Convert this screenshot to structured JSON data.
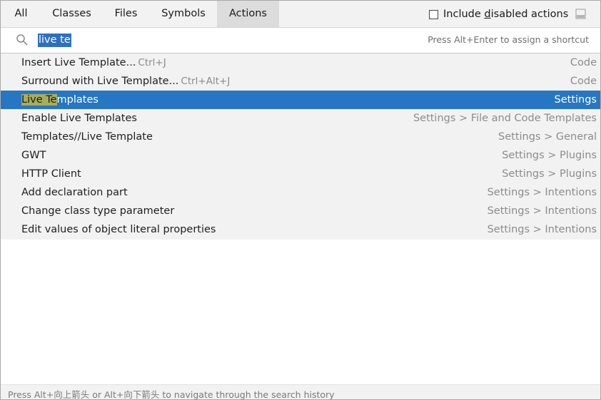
{
  "tabs": [
    {
      "label": "All",
      "active": false
    },
    {
      "label": "Classes",
      "active": false
    },
    {
      "label": "Files",
      "active": false
    },
    {
      "label": "Symbols",
      "active": false
    },
    {
      "label": "Actions",
      "active": true
    }
  ],
  "include_disabled": {
    "label_pre": "Include ",
    "label_underlined": "d",
    "label_post": "isabled actions",
    "checked": false
  },
  "search": {
    "query": "live te",
    "hint": "Press Alt+Enter to assign a shortcut"
  },
  "results": [
    {
      "name": "Insert Live Template...",
      "shortcut": "Ctrl+J",
      "category": "Code",
      "selected": false
    },
    {
      "name": "Surround with Live Template...",
      "shortcut": "Ctrl+Alt+J",
      "category": "Code",
      "selected": false
    },
    {
      "name_match": "Live Te",
      "name_rest": "mplates",
      "shortcut": "",
      "category": "Settings",
      "selected": true
    },
    {
      "name": "Enable Live Templates",
      "shortcut": "",
      "category": "Settings > File and Code Templates",
      "selected": false
    },
    {
      "name": "Templates//Live Template",
      "shortcut": "",
      "category": "Settings > General",
      "selected": false
    },
    {
      "name": "GWT",
      "shortcut": "",
      "category": "Settings > Plugins",
      "selected": false
    },
    {
      "name": "HTTP Client",
      "shortcut": "",
      "category": "Settings > Plugins",
      "selected": false
    },
    {
      "name": "Add declaration part",
      "shortcut": "",
      "category": "Settings > Intentions",
      "selected": false
    },
    {
      "name": "Change class type parameter",
      "shortcut": "",
      "category": "Settings > Intentions",
      "selected": false
    },
    {
      "name": "Edit values of object literal properties",
      "shortcut": "",
      "category": "Settings > Intentions",
      "selected": false
    }
  ],
  "footer": {
    "text": "Press Alt+向上箭头 or Alt+向下箭头 to navigate through the search history"
  },
  "colors": {
    "selection": "#2676c4",
    "match_highlight": "#a8ad5a",
    "query_selection": "#2e6fc4"
  }
}
